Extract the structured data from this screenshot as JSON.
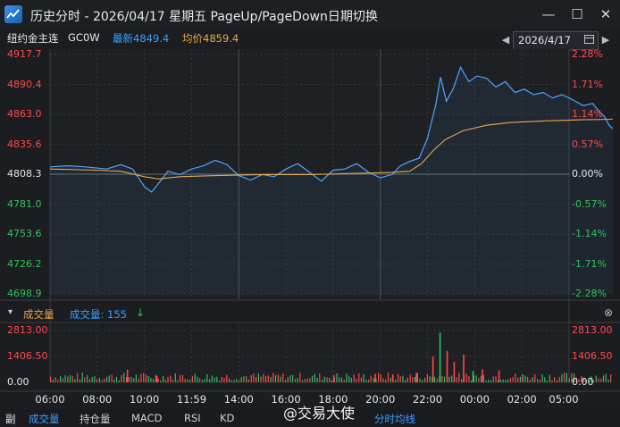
{
  "window": {
    "title": "历史分时 - 2026/04/17 星期五 PageUp/PageDown日期切换",
    "minimize_label": "—",
    "maximize_label": "☐",
    "close_label": "✕"
  },
  "instrument": {
    "name": "纽约金主连",
    "code": "GC0W",
    "latest_label": "最新4849.4",
    "avg_label": "均价4859.4",
    "date_value": "2026/4/17",
    "prev_label": "◀",
    "next_label": "▶"
  },
  "colors": {
    "up": "#ff4a4a",
    "down": "#2fc25b",
    "price_line": "#4fa3ff",
    "avg_line": "#e8a84c",
    "grid": "#34373d",
    "accent_blue": "#3aa0ff"
  },
  "volume": {
    "title": "成交量",
    "value_label": "成交量: 155",
    "arrow": "↓",
    "close_label": "⊗",
    "collapse_label": "▾"
  },
  "bottom_tabs": {
    "side_label": "副",
    "items": [
      "成交量",
      "持仓量",
      "MACD",
      "RSI",
      "KD",
      "分时均线"
    ],
    "active": "成交量"
  },
  "watermark": "@交易大使",
  "chart_data": [
    {
      "type": "line",
      "title": "",
      "x_ticks": [
        "06:00",
        "08:00",
        "10:00",
        "11:59",
        "14:00",
        "16:00",
        "18:00",
        "20:00",
        "22:00",
        "00:00",
        "02:00",
        "05:00"
      ],
      "y_ticks_left": [
        "4917.7",
        "4890.4",
        "4863.0",
        "4835.6",
        "4808.3",
        "4781.0",
        "4753.6",
        "4726.2",
        "4698.9"
      ],
      "y_ticks_right": [
        "2.28%",
        "1.71%",
        "1.14%",
        "0.57%",
        "0.00%",
        "-0.57%",
        "-1.14%",
        "-1.71%",
        "-2.28%"
      ],
      "ylim": [
        4698.9,
        4917.7
      ],
      "reference_price": 4808.3,
      "grid": true,
      "series": [
        {
          "name": "最新",
          "points": [
            [
              0,
              4815
            ],
            [
              1.5,
              4816
            ],
            [
              3,
              4815
            ],
            [
              4.8,
              4813
            ],
            [
              6,
              4817
            ],
            [
              7,
              4813
            ],
            [
              8,
              4797
            ],
            [
              8.6,
              4792
            ],
            [
              9.2,
              4800
            ],
            [
              10,
              4811
            ],
            [
              11,
              4808
            ],
            [
              12,
              4813
            ],
            [
              13,
              4816
            ],
            [
              14,
              4821
            ],
            [
              15,
              4817
            ],
            [
              16,
              4807
            ],
            [
              17,
              4803
            ],
            [
              18,
              4808
            ],
            [
              19,
              4806
            ],
            [
              20,
              4813
            ],
            [
              21,
              4818
            ],
            [
              22,
              4810
            ],
            [
              23,
              4802
            ],
            [
              24,
              4812
            ],
            [
              25,
              4813
            ],
            [
              26,
              4818
            ],
            [
              27,
              4810
            ],
            [
              28,
              4805
            ],
            [
              29,
              4808
            ],
            [
              29.7,
              4816
            ],
            [
              30.5,
              4820
            ],
            [
              31.3,
              4823
            ],
            [
              32,
              4841
            ],
            [
              32.7,
              4872
            ],
            [
              33.1,
              4897
            ],
            [
              33.6,
              4875
            ],
            [
              34.2,
              4887
            ],
            [
              34.8,
              4906
            ],
            [
              35.5,
              4893
            ],
            [
              36.2,
              4898
            ],
            [
              37,
              4896
            ],
            [
              37.8,
              4888
            ],
            [
              38.6,
              4893
            ],
            [
              39.4,
              4883
            ],
            [
              40.2,
              4886
            ],
            [
              41,
              4881
            ],
            [
              41.8,
              4883
            ],
            [
              42.6,
              4878
            ],
            [
              43.4,
              4881
            ],
            [
              44.2,
              4877
            ],
            [
              45.2,
              4871
            ],
            [
              46,
              4873
            ],
            [
              46.6,
              4865
            ],
            [
              47,
              4861
            ],
            [
              47.4,
              4853
            ],
            [
              47.7,
              4850
            ]
          ]
        },
        {
          "name": "均价",
          "points": [
            [
              0,
              4813
            ],
            [
              4,
              4812
            ],
            [
              6,
              4811
            ],
            [
              8,
              4806
            ],
            [
              9.2,
              4804
            ],
            [
              11,
              4806
            ],
            [
              14,
              4807
            ],
            [
              18,
              4808
            ],
            [
              22,
              4808
            ],
            [
              26,
              4809
            ],
            [
              29,
              4810
            ],
            [
              30.5,
              4811
            ],
            [
              31.5,
              4818
            ],
            [
              32.5,
              4830
            ],
            [
              33.5,
              4840
            ],
            [
              35,
              4848
            ],
            [
              37,
              4853
            ],
            [
              39,
              4855.5
            ],
            [
              42,
              4857
            ],
            [
              45,
              4858
            ],
            [
              47.7,
              4858.5
            ]
          ]
        }
      ]
    },
    {
      "type": "bar",
      "title": "成交量",
      "y_ticks": [
        "2813.00",
        "1406.50",
        "0.00"
      ],
      "ylim": [
        0,
        2813
      ],
      "highlights": [
        {
          "x": 6.5,
          "value": 700,
          "direction": "up"
        },
        {
          "x": 9,
          "value": 350,
          "direction": "up"
        },
        {
          "x": 24,
          "value": 380,
          "direction": "up"
        },
        {
          "x": 27.5,
          "value": 460,
          "direction": "up"
        },
        {
          "x": 29,
          "value": 430,
          "direction": "up"
        },
        {
          "x": 31,
          "value": 520,
          "direction": "up"
        },
        {
          "x": 32.4,
          "value": 1400,
          "direction": "up"
        },
        {
          "x": 33,
          "value": 2700,
          "direction": "down"
        },
        {
          "x": 33.6,
          "value": 1700,
          "direction": "up"
        },
        {
          "x": 34.2,
          "value": 1100,
          "direction": "up"
        },
        {
          "x": 35,
          "value": 1500,
          "direction": "up"
        },
        {
          "x": 35.8,
          "value": 620,
          "direction": "down"
        },
        {
          "x": 36.6,
          "value": 700,
          "direction": "up"
        },
        {
          "x": 38,
          "value": 650,
          "direction": "up"
        },
        {
          "x": 40,
          "value": 300,
          "direction": "up"
        }
      ]
    }
  ]
}
